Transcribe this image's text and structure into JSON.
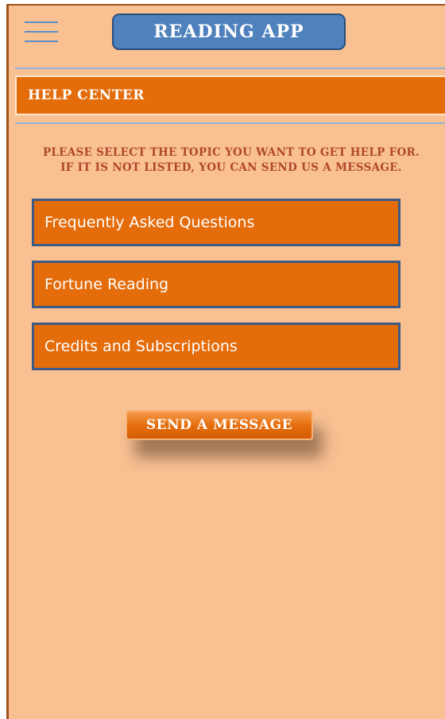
{
  "header": {
    "title": "READING APP",
    "menu_icon": "hamburger-menu-icon"
  },
  "help_center": {
    "title": "HELP CENTER",
    "instructions_line1": "PLEASE SELECT THE TOPIC YOU WANT TO GET HELP FOR.",
    "instructions_line2": "IF IT IS NOT LISTED, YOU CAN SEND US A MESSAGE."
  },
  "topics": [
    {
      "label": "Frequently Asked Questions"
    },
    {
      "label": "Fortune Reading"
    },
    {
      "label": "Credits and Subscriptions"
    }
  ],
  "actions": {
    "send_message_label": "SEND A MESSAGE"
  },
  "colors": {
    "background": "#f9c092",
    "accent_orange": "#e46c0a",
    "title_blue": "#4f81bd",
    "border_navy": "#3b5b84",
    "instruction_text": "#b0472a"
  }
}
